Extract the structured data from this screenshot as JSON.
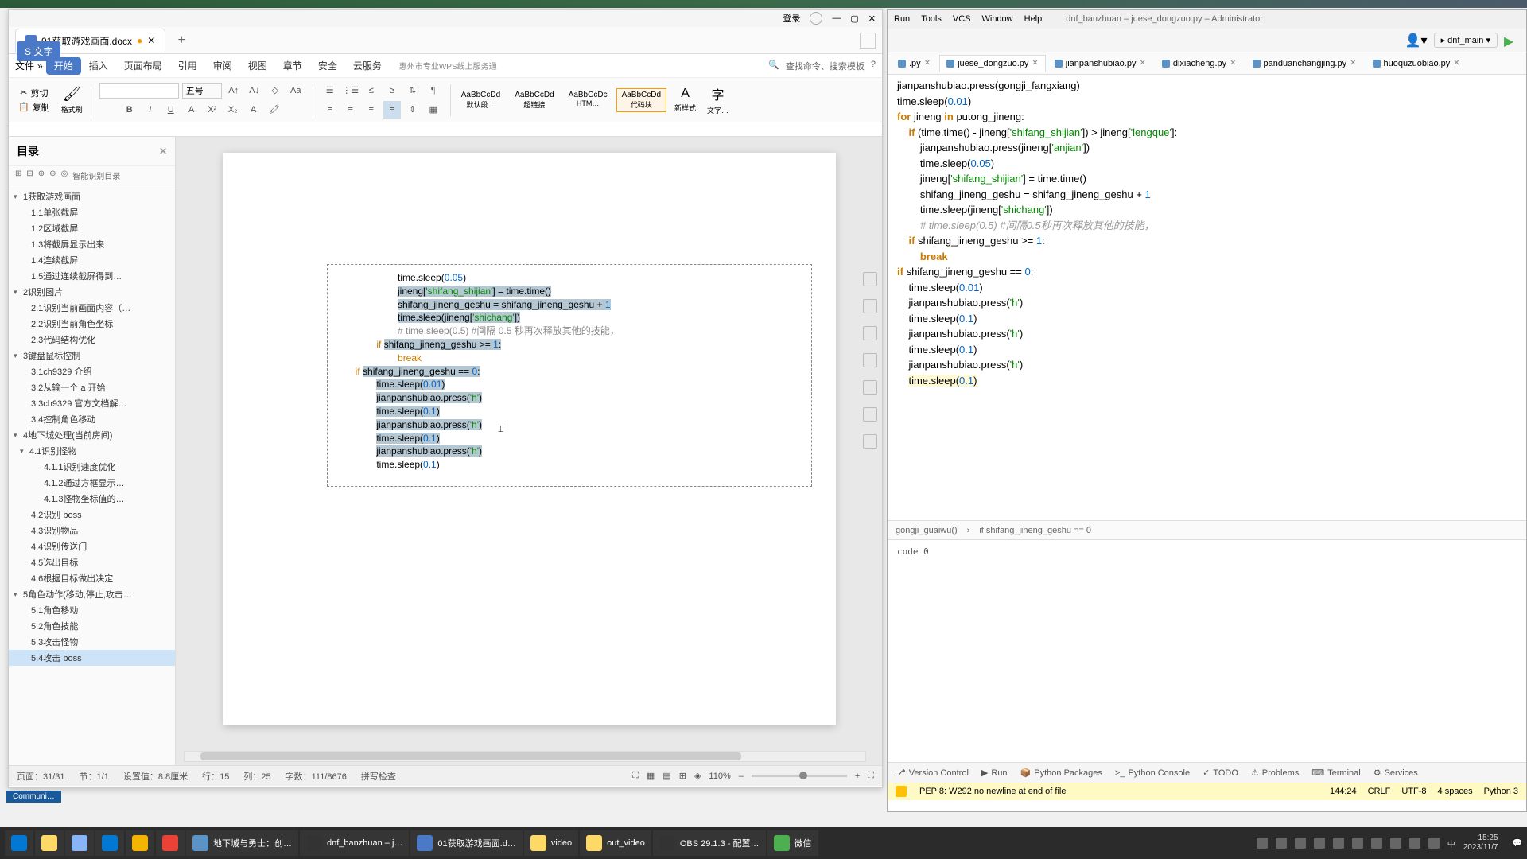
{
  "wps": {
    "login": "登录",
    "tab_title": "01获取游戏画面.docx",
    "file_menu": "文件",
    "pill": "S 文字",
    "ribbon_tabs": [
      "开始",
      "插入",
      "页面布局",
      "引用",
      "审阅",
      "视图",
      "章节",
      "安全",
      "云服务"
    ],
    "ribbon_banner": "惠州市专业WPS线上服务通",
    "search_q": "查找命令、搜索模板",
    "clipboard": {
      "cut": "剪切",
      "copy": "复制",
      "paste": "格式刷"
    },
    "font_size_label": "五号",
    "styles": [
      {
        "preview": "AaBbCcDd",
        "name": "默认段…"
      },
      {
        "preview": "AaBbCcDd",
        "name": "超链接"
      },
      {
        "preview": "AaBbCcDc",
        "name": "HTM…"
      },
      {
        "preview": "AaBbCcDd",
        "name": "代码块"
      }
    ],
    "new_style": "新样式",
    "text_tool": "文字…",
    "outline": {
      "title": "目录",
      "smart": "智能识别目录",
      "items": [
        {
          "level": 0,
          "text": "1获取游戏画面",
          "expanded": true
        },
        {
          "level": 1,
          "text": "1.1单张截屏"
        },
        {
          "level": 1,
          "text": "1.2区域截屏"
        },
        {
          "level": 1,
          "text": "1.3将截屏显示出来"
        },
        {
          "level": 1,
          "text": "1.4连续截屏"
        },
        {
          "level": 1,
          "text": "1.5通过连续截屏得到…"
        },
        {
          "level": 0,
          "text": "2识别图片",
          "expanded": true
        },
        {
          "level": 1,
          "text": "2.1识别当前画面内容（…"
        },
        {
          "level": 1,
          "text": "2.2识别当前角色坐标"
        },
        {
          "level": 1,
          "text": "2.3代码结构优化"
        },
        {
          "level": 0,
          "text": "3键盘鼠标控制",
          "expanded": true
        },
        {
          "level": 1,
          "text": "3.1ch9329 介绍"
        },
        {
          "level": 1,
          "text": "3.2从输一个 a 开始"
        },
        {
          "level": 1,
          "text": "3.3ch9329 官方文档解…"
        },
        {
          "level": 1,
          "text": "3.4控制角色移动"
        },
        {
          "level": 0,
          "text": "4地下城处理(当前房间)",
          "expanded": true
        },
        {
          "level": 1,
          "text": "4.1识别怪物",
          "expanded": true
        },
        {
          "level": 2,
          "text": "4.1.1识别速度优化"
        },
        {
          "level": 2,
          "text": "4.1.2通过方框显示…"
        },
        {
          "level": 2,
          "text": "4.1.3怪物坐标值的…"
        },
        {
          "level": 1,
          "text": "4.2识别 boss"
        },
        {
          "level": 1,
          "text": "4.3识别物品"
        },
        {
          "level": 1,
          "text": "4.4识别传送门"
        },
        {
          "level": 1,
          "text": "4.5选出目标"
        },
        {
          "level": 1,
          "text": "4.6根据目标做出决定"
        },
        {
          "level": 0,
          "text": "5角色动作(移动,停止,攻击…",
          "expanded": true
        },
        {
          "level": 1,
          "text": "5.1角色移动"
        },
        {
          "level": 1,
          "text": "5.2角色技能"
        },
        {
          "level": 1,
          "text": "5.3攻击怪物"
        },
        {
          "level": 1,
          "text": "5.4攻击 boss",
          "selected": true
        }
      ]
    },
    "code_lines": [
      {
        "indent": 6,
        "html": "time.sleep(<span class='num'>0.05</span>)"
      },
      {
        "indent": 6,
        "html": "<span class='sel'>jineng[<span class='str'>'shifang_shijian'</span>] = time.time()</span>"
      },
      {
        "indent": 6,
        "html": "<span class='sel'>shifang_jineng_geshu = shifang_jineng_geshu + <span class='num'>1</span></span>"
      },
      {
        "indent": 6,
        "html": "<span class='sel'>time.sleep(jineng[<span class='str'>'shichang'</span>])</span>"
      },
      {
        "indent": 6,
        "html": "<span class='cmt'># time.sleep(0.5) #间隔 0.5 秒再次释放其他的技能，</span>"
      },
      {
        "indent": 4,
        "html": "<span class='kw'>if</span> <span class='sel'>shifang_jineng_geshu &gt;= <span class='num'>1</span>:</span>"
      },
      {
        "indent": 6,
        "html": "<span class='kw'>break</span>"
      },
      {
        "indent": 2,
        "html": "<span class='kw'>if</span> <span class='sel'>shifang_jineng_geshu == <span class='num'>0</span>:</span>"
      },
      {
        "indent": 4,
        "html": "<span class='sel'>time.sleep(<span class='num'>0.01</span>)</span>"
      },
      {
        "indent": 4,
        "html": "<span class='sel'>jianpanshubiao.press(<span class='str'>'h'</span>)</span>"
      },
      {
        "indent": 4,
        "html": "<span class='sel'>time.sleep(<span class='num'>0.1</span>)</span>"
      },
      {
        "indent": 4,
        "html": "<span class='sel'>jianpanshubiao.press(<span class='str'>'h'</span>)</span>"
      },
      {
        "indent": 4,
        "html": "<span class='sel'>time.sleep(<span class='num'>0.1</span>)</span>"
      },
      {
        "indent": 4,
        "html": "<span class='sel'>jianpanshubiao.press(<span class='str'>'h'</span>)</span>"
      },
      {
        "indent": 4,
        "html": "time.sleep(<span class='num'>0.1</span>)"
      }
    ],
    "status": {
      "page": "页面：31/31",
      "section": "节：1/1",
      "pos": "设置值：8.8厘米",
      "line": "行：15",
      "col": "列：25",
      "chars": "字数：111/8676",
      "spell": "拼写检查",
      "zoom": "110%"
    }
  },
  "pycharm": {
    "menu": [
      "Run",
      "Tools",
      "VCS",
      "Window",
      "Help"
    ],
    "title": "dnf_banzhuan – juese_dongzuo.py – Administrator",
    "run_config": "dnf_main",
    "tabs": [
      {
        "name": ".py"
      },
      {
        "name": "juese_dongzuo.py",
        "active": true
      },
      {
        "name": "jianpanshubiao.py"
      },
      {
        "name": "dixiacheng.py"
      },
      {
        "name": "panduanchangjing.py"
      },
      {
        "name": "huoquzuobiao.py"
      }
    ],
    "code": [
      {
        "i": 0,
        "h": "jianpanshubiao.press(gongji_fangxiang)"
      },
      {
        "i": 0,
        "h": "time.sleep(<span class='py-num'>0.01</span>)"
      },
      {
        "i": 0,
        "h": ""
      },
      {
        "i": 0,
        "h": "<span class='py-kw'>for</span> jineng <span class='py-kw'>in</span> putong_jineng:"
      },
      {
        "i": 1,
        "h": "<span class='py-kw'>if</span> (time.time() - jineng[<span class='py-str'>'shifang_shijian'</span>]) &gt; jineng[<span class='py-str'>'lengque'</span>]:"
      },
      {
        "i": 2,
        "h": "jianpanshubiao.press(jineng[<span class='py-str'>'anjian'</span>])"
      },
      {
        "i": 2,
        "h": "time.sleep(<span class='py-num'>0.05</span>)"
      },
      {
        "i": 2,
        "h": "jineng[<span class='py-str'>'shifang_shijian'</span>] = time.time()"
      },
      {
        "i": 2,
        "h": "shifang_jineng_geshu = shifang_jineng_geshu + <span class='py-num'>1</span>"
      },
      {
        "i": 2,
        "h": "time.sleep(jineng[<span class='py-str'>'shichang'</span>])"
      },
      {
        "i": 2,
        "h": "<span class='py-cmt'># time.sleep(0.5) #间隔0.5秒再次释放其他的技能，</span>"
      },
      {
        "i": 1,
        "h": "<span class='py-kw'>if</span> shifang_jineng_geshu &gt;= <span class='py-num'>1</span>:"
      },
      {
        "i": 2,
        "h": "<span class='py-kw'>break</span>"
      },
      {
        "i": 0,
        "h": "<span class='py-kw'>if</span> shifang_jineng_geshu == <span class='py-num'>0</span>:"
      },
      {
        "i": 1,
        "h": "time.sleep(<span class='py-num'>0.01</span>)"
      },
      {
        "i": 1,
        "h": "jianpanshubiao.press(<span class='py-str'>'h'</span>)"
      },
      {
        "i": 1,
        "h": "time.sleep(<span class='py-num'>0.1</span>)"
      },
      {
        "i": 1,
        "h": "jianpanshubiao.press(<span class='py-str'>'h'</span>)"
      },
      {
        "i": 1,
        "h": "time.sleep(<span class='py-num'>0.1</span>)"
      },
      {
        "i": 1,
        "h": "jianpanshubiao.press(<span class='py-str'>'h'</span>)"
      },
      {
        "i": 1,
        "h": "<span class='py-hl'>time.sleep(<span class='py-num'>0.1</span>)</span>"
      }
    ],
    "breadcrumb": [
      "gongji_guaiwu()",
      "if shifang_jineng_geshu == 0"
    ],
    "run_output": "code 0",
    "bottom_tabs": [
      "Version Control",
      "Run",
      "Python Packages",
      "Python Console",
      "TODO",
      "Problems",
      "Terminal",
      "Services"
    ],
    "status": {
      "warning": "PEP 8: W292 no newline at end of file",
      "pos": "144:24",
      "eol": "CRLF",
      "enc": "UTF-8",
      "indent": "4 spaces",
      "interp": "Python 3"
    }
  },
  "taskbar": {
    "items": [
      {
        "icon": "#0078d4",
        "label": ""
      },
      {
        "icon": "#ffd966",
        "label": ""
      },
      {
        "icon": "#8ab4f8",
        "label": ""
      },
      {
        "icon": "#0078d4",
        "label": ""
      },
      {
        "icon": "#f4b400",
        "label": ""
      },
      {
        "icon": "#ea4335",
        "label": ""
      },
      {
        "icon": "#5b93c7",
        "label": "地下城与勇士：创…"
      },
      {
        "icon": "#333",
        "label": "dnf_banzhuan – j…"
      },
      {
        "icon": "#4a7ac7",
        "label": "01获取游戏画面.d…"
      },
      {
        "icon": "#ffd966",
        "label": "video"
      },
      {
        "icon": "#ffd966",
        "label": "out_video"
      },
      {
        "icon": "#333",
        "label": "OBS 29.1.3 - 配置…"
      },
      {
        "icon": "#4caf50",
        "label": "微信"
      }
    ],
    "time": "15:25",
    "date": "2023/11/7"
  },
  "commun": "Communi…"
}
